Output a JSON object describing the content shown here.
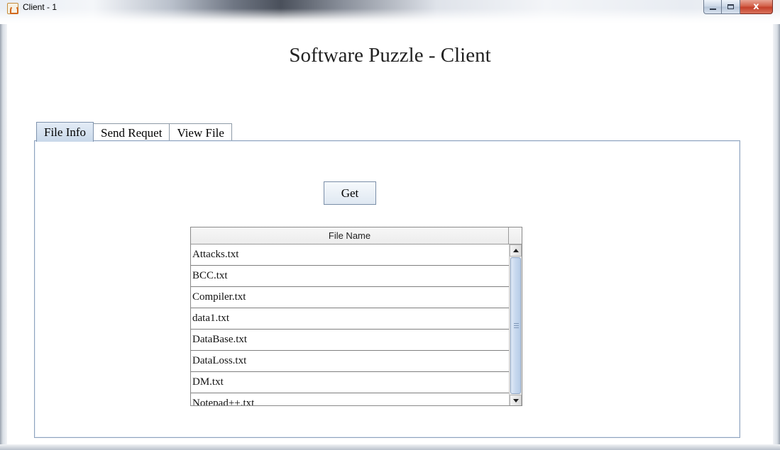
{
  "window": {
    "title": "Client - 1",
    "icon": "java-icon",
    "controls": {
      "minimize_icon": "minimize-icon",
      "maximize_icon": "maximize-icon",
      "close_label": "x"
    }
  },
  "app": {
    "heading": "Software Puzzle - Client"
  },
  "tabs": [
    {
      "label": "File Info",
      "active": true
    },
    {
      "label": "Send Requet",
      "active": false
    },
    {
      "label": "View File",
      "active": false
    }
  ],
  "file_info": {
    "get_button_label": "Get",
    "table": {
      "header": "File Name",
      "rows": [
        "Attacks.txt",
        "BCC.txt",
        "Compiler.txt",
        "data1.txt",
        "DataBase.txt",
        "DataLoss.txt",
        "DM.txt",
        "Notepad++.txt"
      ]
    }
  },
  "colors": {
    "close_button": "#c4402a",
    "active_tab": "#c9d8ea",
    "panel_border": "#8fa3bd"
  }
}
